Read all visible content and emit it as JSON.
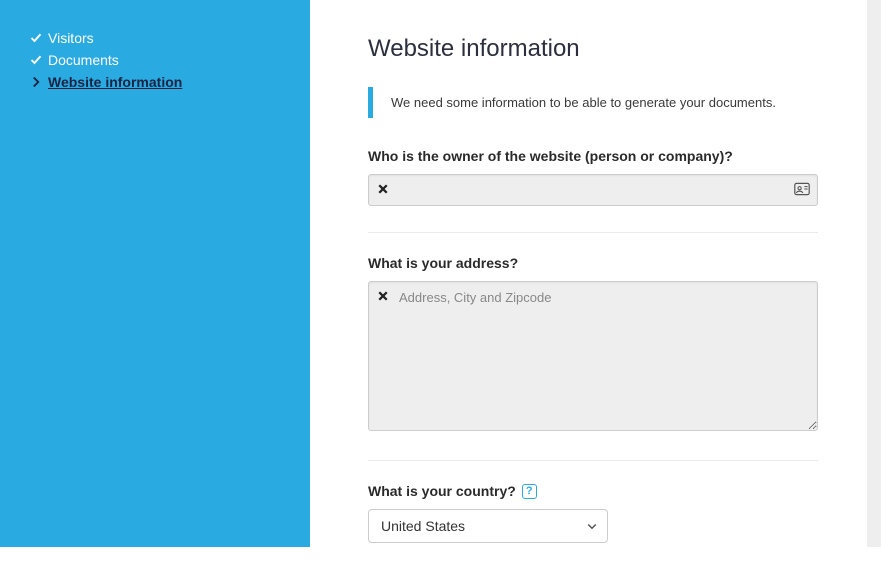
{
  "sidebar": {
    "items": [
      {
        "label": "Visitors",
        "completed": true,
        "active": false
      },
      {
        "label": "Documents",
        "completed": true,
        "active": false
      },
      {
        "label": "Website information",
        "completed": false,
        "active": true
      }
    ]
  },
  "main": {
    "title": "Website information",
    "callout": "We need some information to be able to generate your documents.",
    "fields": {
      "owner": {
        "label": "Who is the owner of the website (person or company)?",
        "value": "",
        "placeholder": ""
      },
      "address": {
        "label": "What is your address?",
        "value": "",
        "placeholder": "Address, City and Zipcode"
      },
      "country": {
        "label": "What is your country?",
        "selected": "United States",
        "help_icon": "?"
      }
    }
  }
}
